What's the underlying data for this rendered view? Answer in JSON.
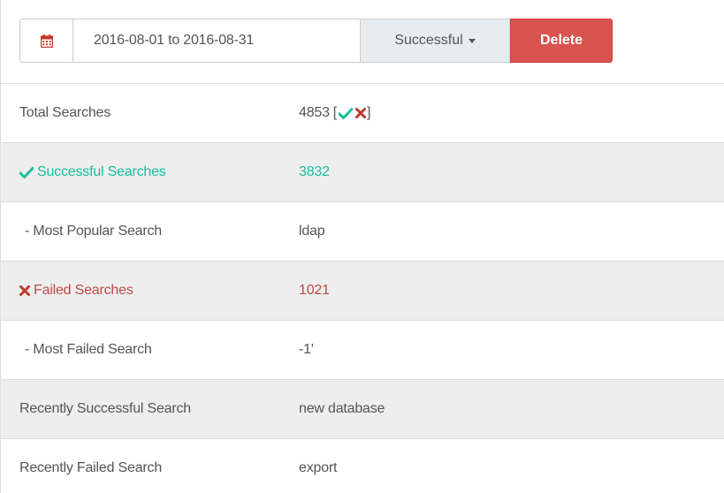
{
  "toolbar": {
    "date_range": "2016-08-01 to 2016-08-31",
    "filter_label": "Successful",
    "delete_label": "Delete"
  },
  "colors": {
    "success": "#1abc9c",
    "danger": "#d9534f",
    "failed_text": "#b94a48"
  },
  "stats": {
    "total": {
      "label": "Total Searches",
      "value": "4853",
      "open": "[",
      "close": "]"
    },
    "successful": {
      "label": "Successful Searches",
      "value": "3832"
    },
    "most_popular": {
      "label": "- Most Popular Search",
      "value": "ldap"
    },
    "failed": {
      "label": "Failed Searches",
      "value": "1021"
    },
    "most_failed": {
      "label": "- Most Failed Search",
      "value": "-1'"
    },
    "recent_success": {
      "label": "Recently Successful Search",
      "value": "new database"
    },
    "recent_failed": {
      "label": "Recently Failed Search",
      "value": "export"
    }
  },
  "icons": {
    "calendar": "calendar-icon",
    "check": "check-icon",
    "cross": "cross-icon"
  }
}
